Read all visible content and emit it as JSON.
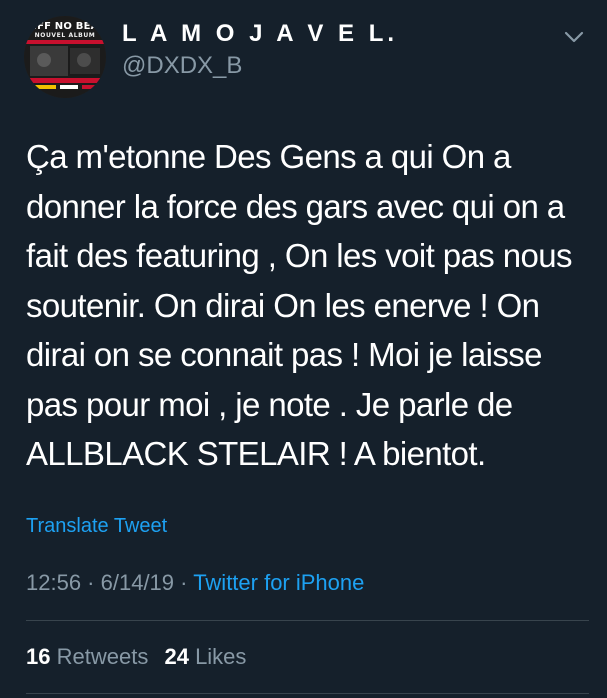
{
  "author": {
    "display_name": "L A  M O J A V E L.",
    "handle": "@DXDX_B",
    "avatar": {
      "line1": "AIFF NO BEAT",
      "line2": "NOUVEL ALBUM",
      "colors": [
        "#1b1b1b",
        "#c8102e",
        "#f2c200"
      ]
    }
  },
  "header": {
    "menu_icon": "chevron-down-icon"
  },
  "tweet": {
    "lines": [
      "Ça m'etonne Des Gens a qui On a",
      "donner la force des gars avec qui on a",
      "fait des featuring , On les voit pas nous",
      "soutenir. On dirai On les enerve !  On",
      "dirai on se connait pas ! Moi je laisse",
      "pas pour moi , je note . Je parle de",
      "ALLBLACK STELAIR ! A bientot."
    ]
  },
  "translate_label": "Translate Tweet",
  "meta": {
    "time": "12:56",
    "sep1": " · ",
    "date": "6/14/19",
    "sep2": " · ",
    "source": "Twitter for iPhone"
  },
  "stats": {
    "retweets_count": "16",
    "retweets_label": "Retweets",
    "likes_count": "24",
    "likes_label": "Likes"
  },
  "colors": {
    "background": "#15202b",
    "text": "#ffffff",
    "secondary": "#8899a6",
    "accent": "#1da1f2",
    "divider": "#38444d"
  }
}
